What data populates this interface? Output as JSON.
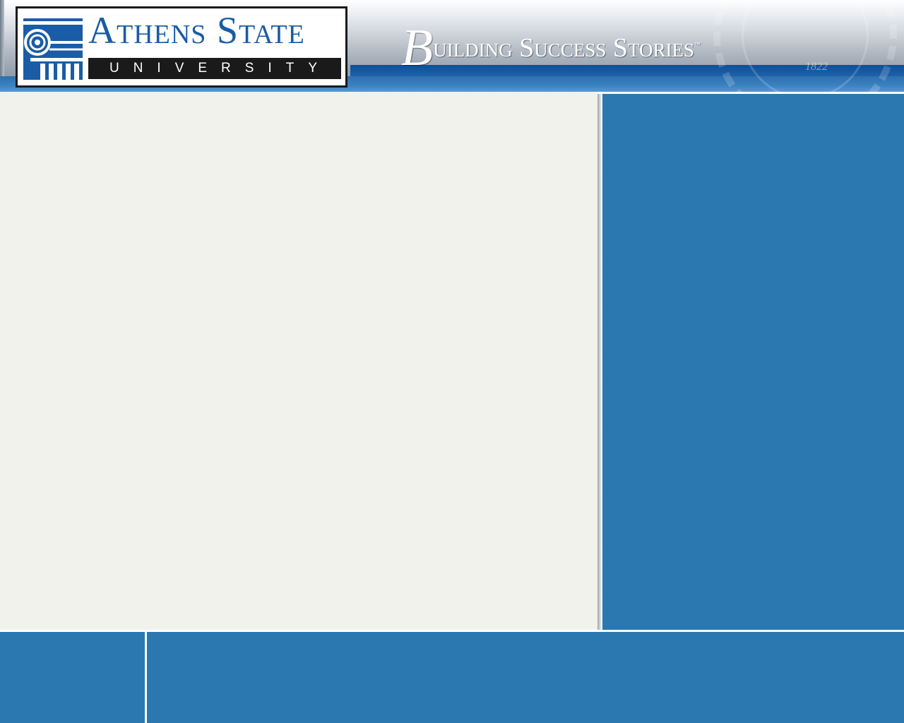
{
  "header": {
    "logo": {
      "name": "Athens State",
      "subtitle": "UNIVERSITY",
      "icon": "ionic-column-icon",
      "brand_color": "#1a5ca6"
    },
    "tagline": {
      "initial": "B",
      "rest": "uilding Success Stories",
      "trademark": "™"
    },
    "seal": {
      "icon": "university-seal-icon",
      "year": "1822"
    }
  },
  "colors": {
    "panel_blue": "#2b78b0",
    "content_bg": "#f2f2ed",
    "header_band": "#1e64ad"
  }
}
